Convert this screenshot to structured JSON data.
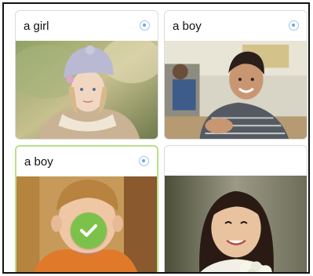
{
  "cards": [
    {
      "label": "a girl",
      "photo": "girl-with-knit-hat",
      "state": "unselected"
    },
    {
      "label": "a boy",
      "photo": "boy-at-desk",
      "state": "unselected"
    },
    {
      "label": "a boy",
      "photo": "blond-boy",
      "state": "correct"
    },
    {
      "label": "",
      "photo": "girl-with-bob",
      "state": "unselected"
    }
  ],
  "colors": {
    "accent_correct": "#7cc24a",
    "selected_border": "#b9e08a",
    "radio": "#6aa8e6"
  },
  "icons": {
    "radio": "radio-icon",
    "check": "checkmark-icon"
  }
}
